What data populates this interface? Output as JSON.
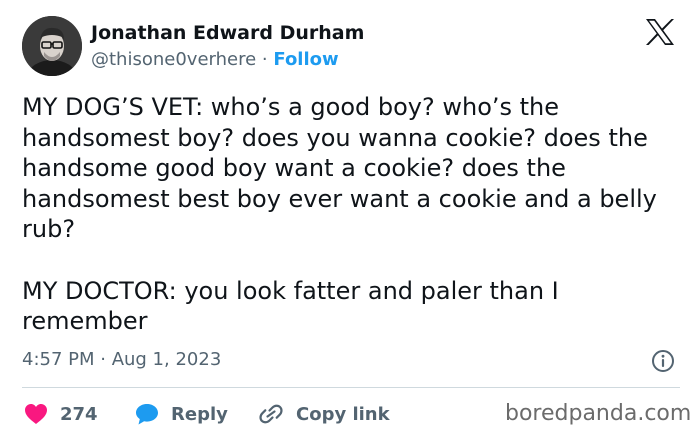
{
  "author": {
    "name": "Jonathan Edward Durham",
    "handle": "@thisone0verhere",
    "separator": "·",
    "follow_label": "Follow"
  },
  "tweet": {
    "paragraphs": [
      "MY DOG’S VET: who’s a good boy? who’s the handsomest boy? does you wanna cookie? does the handsome good boy want a cookie? does the handsomest best boy ever want a cookie and a belly rub?",
      "MY DOCTOR: you look fatter and paler than I remember"
    ],
    "timestamp": "4:57 PM · Aug 1, 2023"
  },
  "actions": {
    "likes_count": "274",
    "reply_label": "Reply",
    "copy_link_label": "Copy link"
  },
  "icons": {
    "logo": "x-logo-icon",
    "info": "info-icon",
    "like": "heart-icon",
    "reply": "comment-bubble-icon",
    "copy": "link-icon"
  },
  "colors": {
    "text": "#0f1419",
    "secondary": "#536471",
    "accent": "#1d9bf0",
    "like": "#f91880",
    "divider": "#cfd9de"
  },
  "watermark": "boredpanda.com"
}
